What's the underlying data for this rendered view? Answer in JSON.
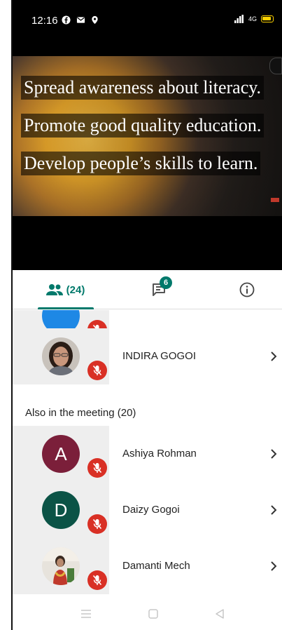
{
  "status_bar": {
    "time": "12:16",
    "icons": [
      "facebook-icon",
      "gmail-icon",
      "location-icon"
    ],
    "signal_text": "4G"
  },
  "video": {
    "lines": [
      "Spread awareness about literacy.",
      "Promote good quality education.",
      "Develop people’s skills to learn."
    ]
  },
  "tabs": {
    "people_count": "(24)",
    "chat_badge": "6"
  },
  "participants_top": [
    {
      "name": "INDIRA GOGOI",
      "avatar_type": "photo",
      "muted": true
    }
  ],
  "also_in_meeting": {
    "label": "Also in the meeting (20)",
    "participants": [
      {
        "name": "Ashiya Rohman",
        "initial": "A",
        "color": "#7b1f3a",
        "muted": true
      },
      {
        "name": "Daizy Gogoi",
        "initial": "D",
        "color": "#0b5346",
        "muted": true
      },
      {
        "name": "Damanti Mech",
        "avatar_type": "photo",
        "muted": true
      }
    ]
  },
  "colors": {
    "accent": "#00796b",
    "mute_red": "#d93025",
    "partial_avatar": "#1e88e5"
  }
}
